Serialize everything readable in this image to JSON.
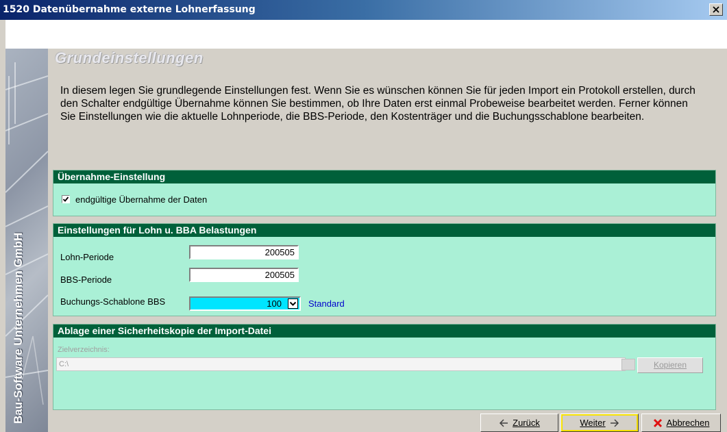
{
  "window": {
    "title": "1520 Datenübernahme externe Lohnerfassung",
    "close_glyph": "×"
  },
  "sidebar": {
    "brand": "Bau-Software Unternehmen GmbH"
  },
  "page": {
    "heading": "Grundeinstellungen",
    "description": "In diesem legen Sie grundlegende Einstellungen fest. Wenn Sie es wünschen können Sie für jeden Import ein Protokoll erstellen, durch den Schalter endgültige Übernahme können Sie bestimmen, ob Ihre Daten erst einmal Probeweise bearbeitet werden. Ferner können Sie Einstellungen wie die aktuelle Lohnperiode, die BBS-Periode, den Kostenträger und die Buchungsschablone bearbeiten."
  },
  "uebernahme": {
    "title": "Übernahme-Einstellung",
    "checkbox_label": "endgültige Übernahme der Daten",
    "checked": true
  },
  "lohn": {
    "title": "Einstellungen für Lohn u. BBA Belastungen",
    "lohn_periode_label": "Lohn-Periode",
    "lohn_periode_value": "200505",
    "bbs_periode_label": "BBS-Periode",
    "bbs_periode_value": "200505",
    "schablone_label": "Buchungs-Schablone BBS",
    "schablone_value": "100",
    "schablone_name": "Standard"
  },
  "ablage": {
    "title": "Ablage einer Sicherheitskopie der Import-Datei",
    "zielverzeichnis_label": "Zielverzeichnis:",
    "zielverzeichnis_value": "C:\\",
    "kopieren_label": "Kopieren"
  },
  "footer": {
    "zurueck_label": "Zurück",
    "weiter_label": "Weiter",
    "abbrechen_label": "Abbrechen"
  },
  "colors": {
    "panel_bg": "#aaf0d6",
    "panel_header": "#00603a",
    "combo_bg": "#00e5ff",
    "link": "#0000cc"
  }
}
